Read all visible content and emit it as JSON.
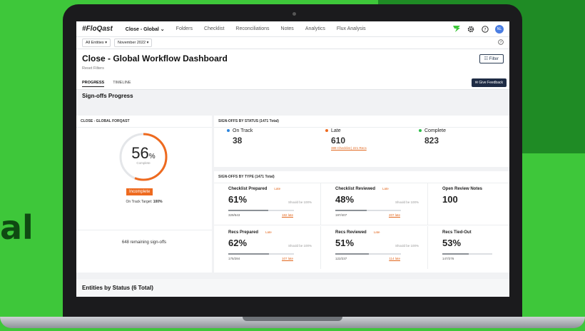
{
  "background": {
    "text": "al"
  },
  "nav": {
    "logo": "#FloQast",
    "items": [
      "Close - Global ⌄",
      "Folders",
      "Checklist",
      "Reconciliations",
      "Notes",
      "Analytics",
      "Flux Analysis"
    ],
    "avatar": "NL",
    "accent": "#3ec73a"
  },
  "subbar": {
    "entities": "All Entities ▾",
    "period": "November 2022 ▾",
    "help": "?"
  },
  "header": {
    "title": "Close - Global Workflow Dashboard",
    "reset": "Reset Filters",
    "filter": "☷ Filter",
    "tabs": [
      "PROGRESS",
      "TIMELINE"
    ],
    "feedback": "✉ Give Feedback"
  },
  "signoffs": {
    "section": "Sign-offs Progress",
    "left_panel": "CLOSE - GLOBAL FORQAST",
    "percent": "56",
    "percent_sym": "%",
    "percent_value": 56,
    "complete_lbl": "Complete",
    "status_badge": "Incomplete",
    "target_label": "On Track Target: ",
    "target_value": "100%",
    "remaining": "648 remaining sign-offs"
  },
  "by_status": {
    "title": "SIGN-OFFS BY STATUS (1471 Total)",
    "items": [
      {
        "label": "On Track",
        "value": "38",
        "color": "#2e86de",
        "sub": ""
      },
      {
        "label": "Late",
        "value": "610",
        "color": "#ee6a1f",
        "sub": "389 Checklist | 221 Recs"
      },
      {
        "label": "Complete",
        "value": "823",
        "color": "#2fbf4a",
        "sub": ""
      }
    ]
  },
  "by_type": {
    "title": "SIGN-OFFS BY TYPE (1471 Total)",
    "cards": [
      {
        "label": "Checklist Prepared",
        "late": "Late",
        "pct": "61%",
        "should": "Should be 100%",
        "count": "329/543",
        "late_count": "182 late",
        "fill": 0.61
      },
      {
        "label": "Checklist Reviewed",
        "late": "Late",
        "pct": "48%",
        "should": "Should be 100%",
        "count": "197/407",
        "late_count": "207 late",
        "fill": 0.48
      },
      {
        "label": "Open Review Notes",
        "late": "",
        "pct": "100",
        "should": "",
        "count": "",
        "late_count": "",
        "fill": 0
      },
      {
        "label": "Recs Prepared",
        "late": "Late",
        "pct": "62%",
        "should": "Should be 100%",
        "count": "175/284",
        "late_count": "107 late",
        "fill": 0.62
      },
      {
        "label": "Recs Reviewed",
        "late": "Late",
        "pct": "51%",
        "should": "Should be 100%",
        "count": "122/237",
        "late_count": "114 late",
        "fill": 0.51
      },
      {
        "label": "Recs Tied-Out",
        "late": "",
        "pct": "53%",
        "should": "",
        "count": "147/276",
        "late_count": "",
        "fill": 0.53
      }
    ]
  },
  "entities": {
    "title": "Entities by Status (6 Total)"
  }
}
